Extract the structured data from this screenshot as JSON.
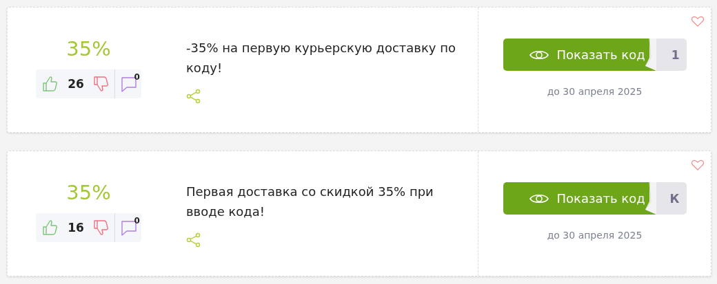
{
  "offers": [
    {
      "discount": "35%",
      "likes": "26",
      "comments": "0",
      "description": "-35% на первую курьерскую доставку по коду!",
      "button": "Показать код",
      "code_peek": "1",
      "expires": "до 30 апреля 2025"
    },
    {
      "discount": "35%",
      "likes": "16",
      "comments": "0",
      "description": "Первая доставка со скидкой 35% при вводе кода!",
      "button": "Показать код",
      "code_peek": "К",
      "expires": "до 30 апреля 2025"
    }
  ]
}
